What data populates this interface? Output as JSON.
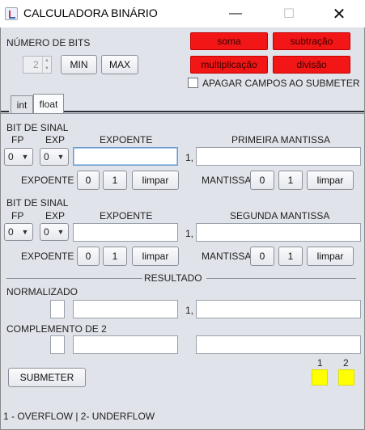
{
  "window": {
    "title": "CALCULADORA BINÁRIO",
    "minimize": "—",
    "maximize": "☐",
    "close": "✕"
  },
  "bits": {
    "label": "NÚMERO DE BITS",
    "value": "2",
    "min_label": "MIN",
    "max_label": "MAX"
  },
  "ops": {
    "soma": "soma",
    "subtracao": "subtração",
    "multiplicacao": "multiplicação",
    "divisao": "divisão"
  },
  "apagar_label": "APAGAR CAMPOS AO SUBMETER",
  "tabs": [
    "int",
    "float"
  ],
  "num1": {
    "bit_de_sinal": "BIT DE SINAL",
    "fp": "FP",
    "exp": "EXP",
    "expoente": "EXPOENTE",
    "mantissa_title": "PRIMEIRA MANTISSA",
    "fp_value": "0",
    "exp_value": "0",
    "comma": "1,",
    "exp_row_label": "EXPOENTE",
    "mant_row_label": "MANTISSA",
    "zero": "0",
    "one": "1",
    "limpar": "limpar"
  },
  "num2": {
    "bit_de_sinal": "BIT DE SINAL",
    "fp": "FP",
    "exp": "EXP",
    "expoente": "EXPOENTE",
    "mantissa_title": "SEGUNDA MANTISSA",
    "fp_value": "0",
    "exp_value": "0",
    "comma": "1,",
    "exp_row_label": "EXPOENTE",
    "mant_row_label": "MANTISSA",
    "zero": "0",
    "one": "1",
    "limpar": "limpar"
  },
  "resultado": {
    "title": "RESULTADO",
    "normalizado": "NORMALIZADO",
    "comma": "1,",
    "complemento": "COMPLEMENTO DE 2"
  },
  "submeter": "SUBMETER",
  "flags": {
    "label1": "1",
    "label2": "2",
    "color": "#ffff00"
  },
  "footer": "1 - OVERFLOW | 2- UNDERFLOW",
  "colors": {
    "op_button": "#f21616",
    "background": "#e1e3ea"
  }
}
